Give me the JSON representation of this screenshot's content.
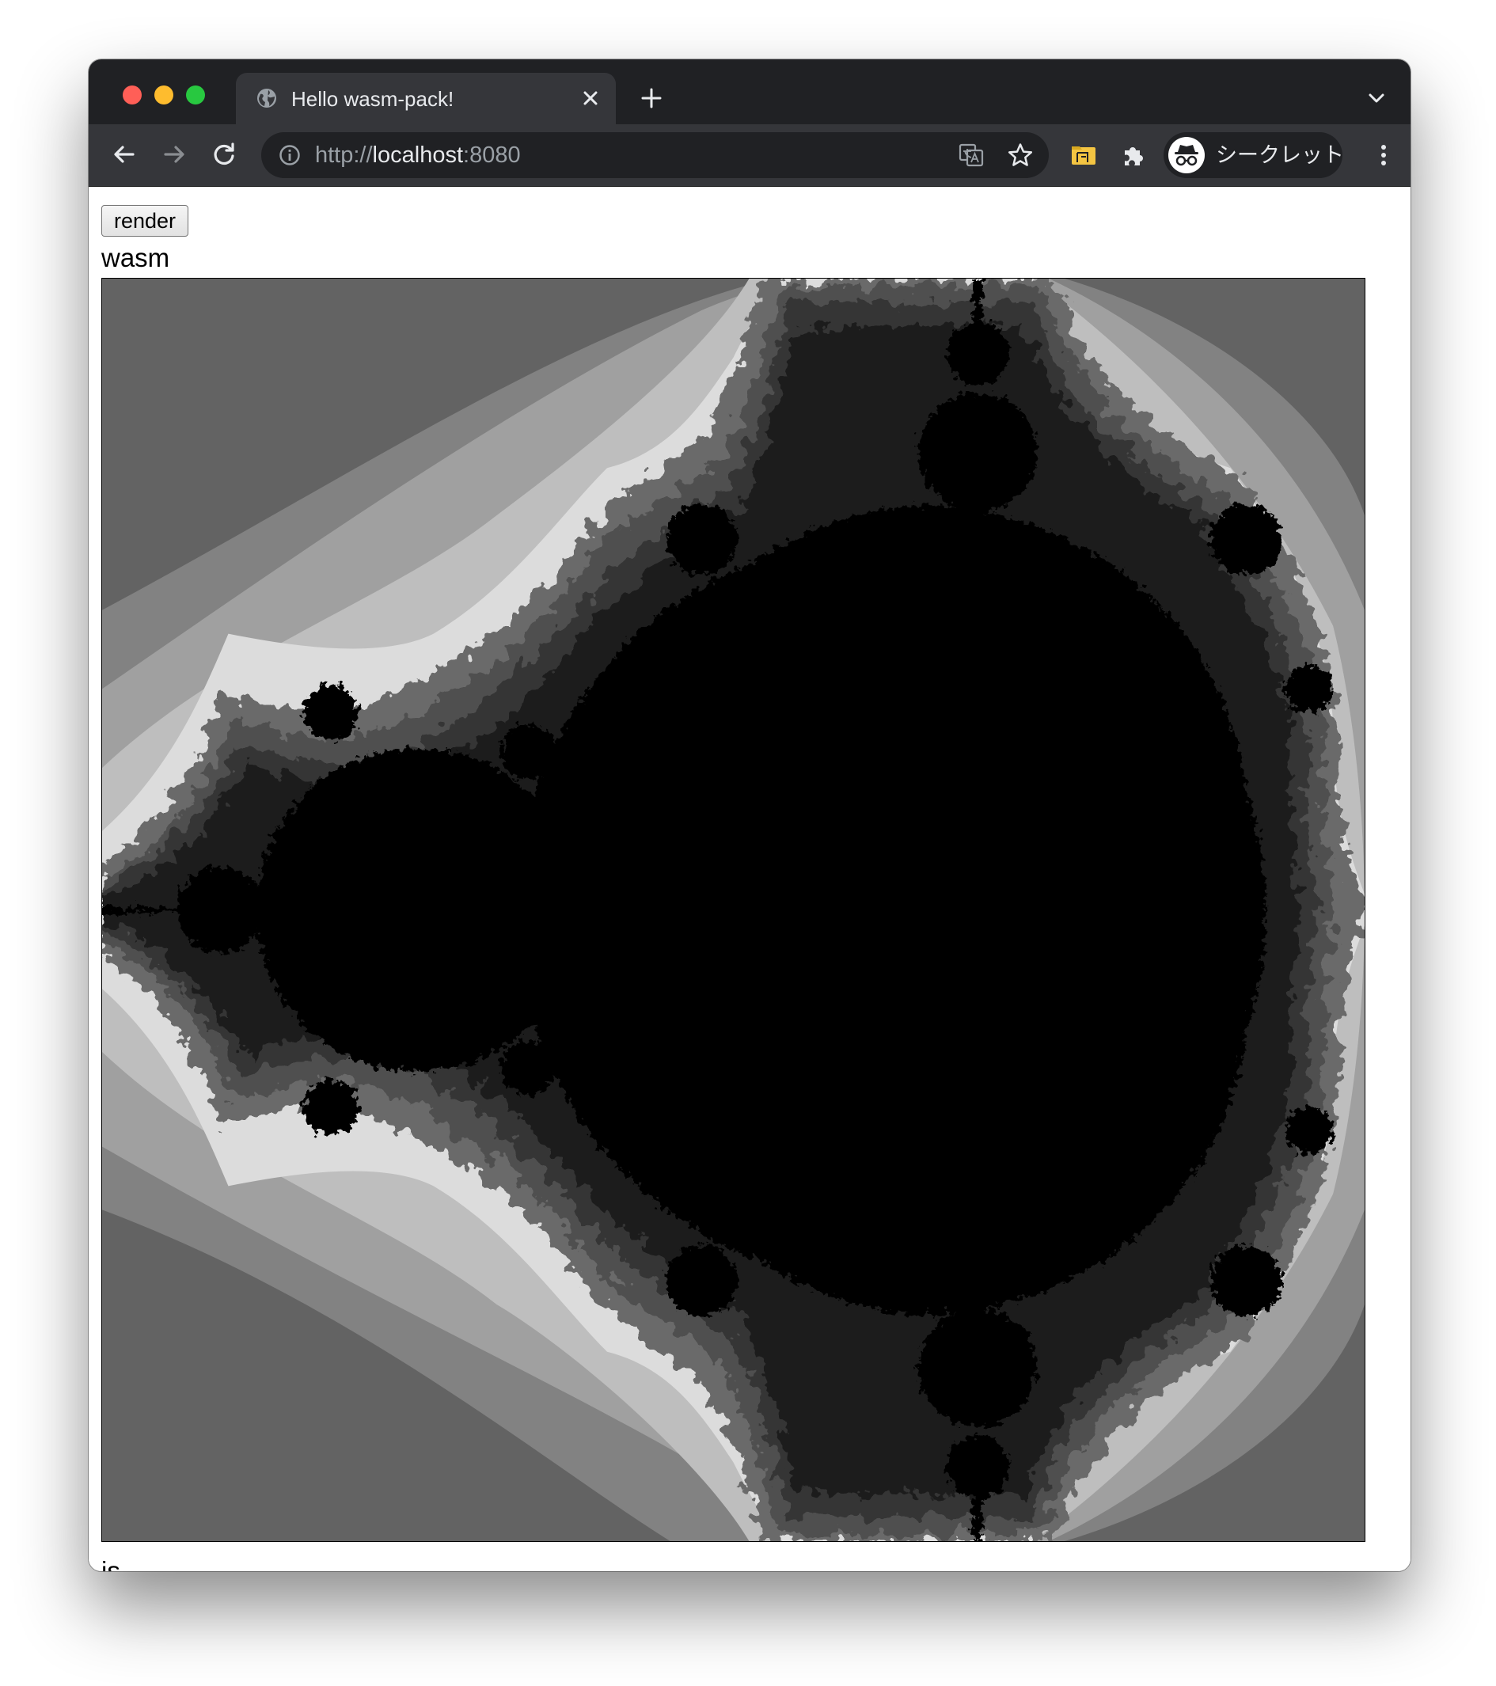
{
  "browser": {
    "tab_title": "Hello wasm-pack!",
    "url_scheme": "http://",
    "url_host": "localhost",
    "url_port": ":8080",
    "profile_label": "シークレット",
    "icons": [
      "globe-icon",
      "close-icon",
      "plus-icon",
      "chevron-down-icon",
      "back-arrow-icon",
      "forward-arrow-icon",
      "reload-icon",
      "info-icon",
      "translate-icon",
      "star-icon",
      "folder-extension-icon",
      "puzzle-icon",
      "incognito-icon",
      "more-vert-icon"
    ],
    "colors": {
      "titlebar": "#202124",
      "toolbar": "#35363a",
      "close": "#ff5f57",
      "minimize": "#febc2e",
      "maximize": "#28c840"
    }
  },
  "page": {
    "render_button_label": "render",
    "heading_wasm": "wasm",
    "heading_js": "js",
    "canvas": {
      "content": "Mandelbrot set",
      "palette": [
        "#000000",
        "#1c1c1c",
        "#363636",
        "#505050",
        "#6a6a6a",
        "#dcdcdc",
        "#bebebe",
        "#a0a0a0",
        "#828282",
        "#636363"
      ]
    }
  }
}
